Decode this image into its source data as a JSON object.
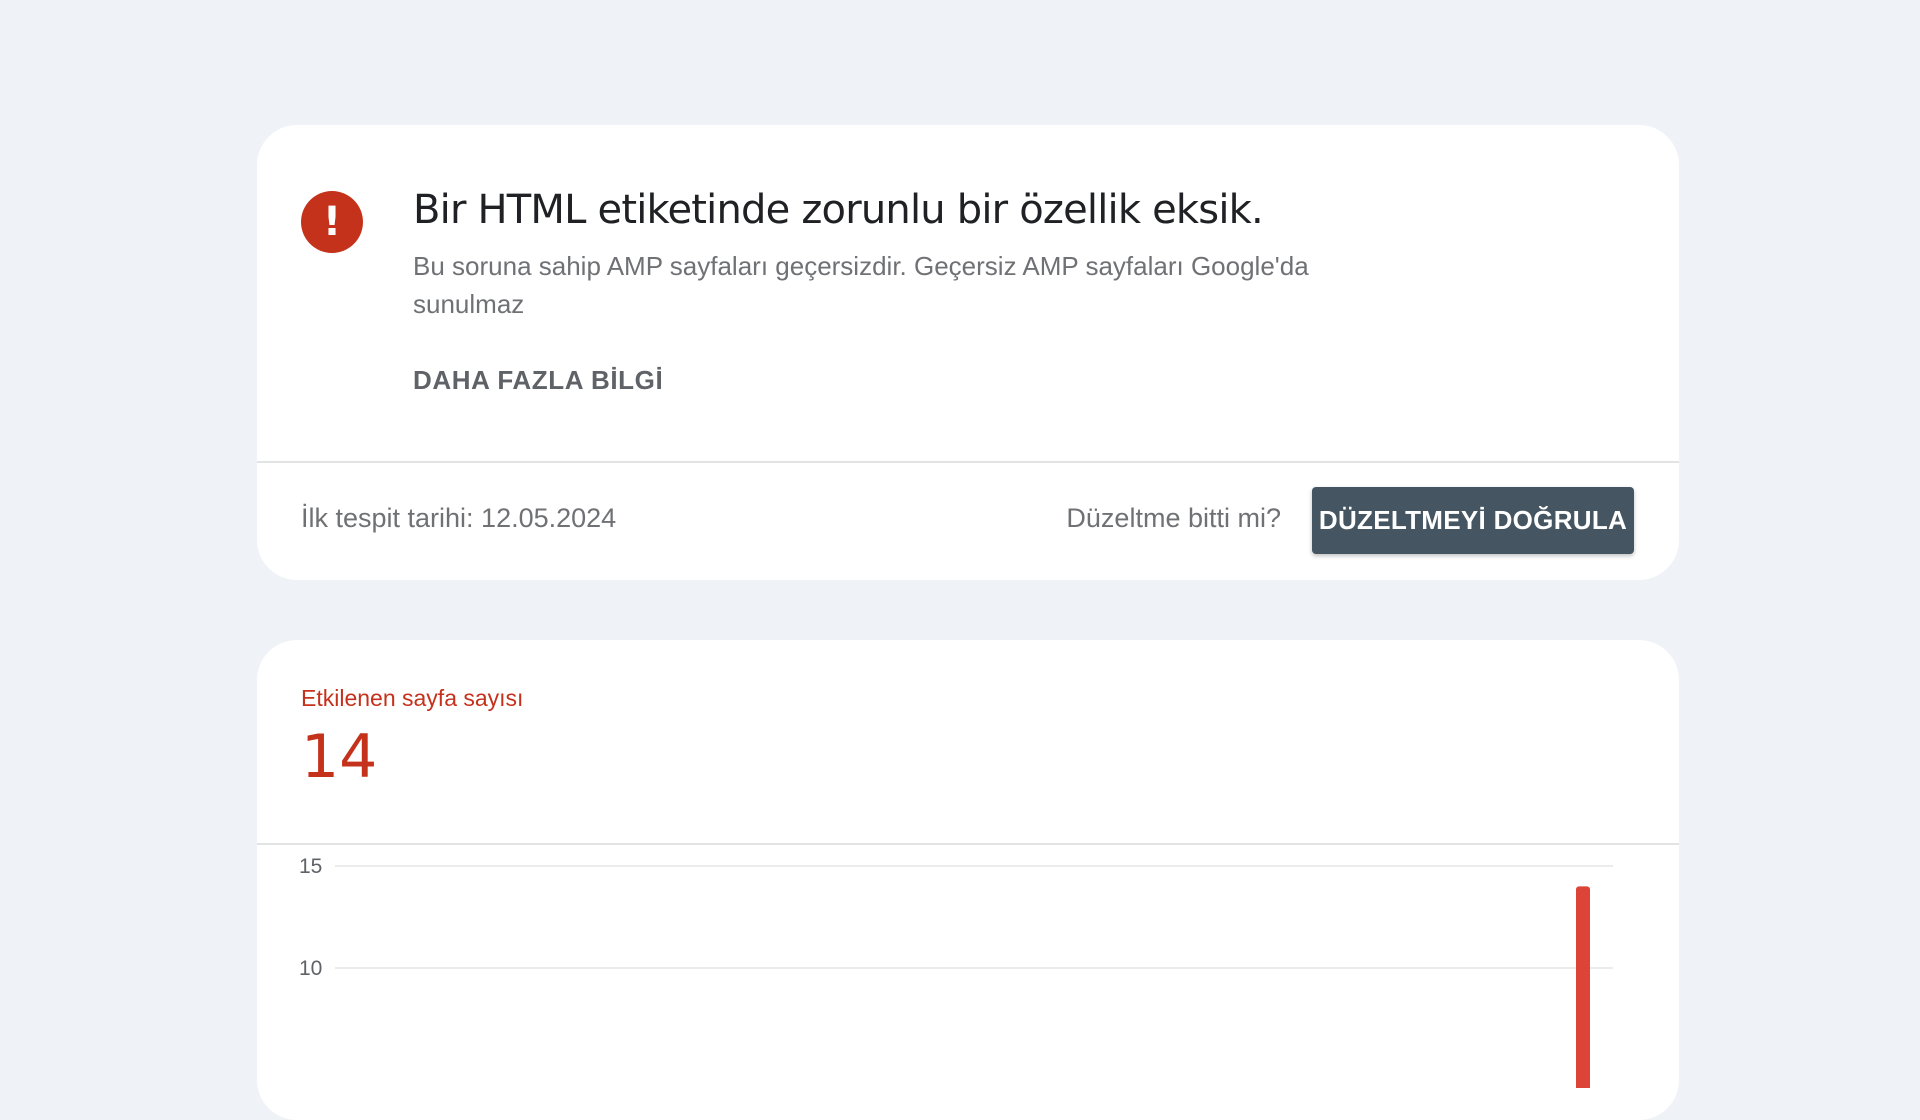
{
  "issue": {
    "title": "Bir HTML etiketinde zorunlu bir özellik eksik.",
    "description": "Bu soruna sahip AMP sayfaları geçersizdir. Geçersiz AMP sayfaları Google'da sunulmaz",
    "learn_more_label": "DAHA FAZLA BİLGİ",
    "first_detected": "İlk tespit tarihi: 12.05.2024",
    "fix_question": "Düzeltme bitti mi?",
    "validate_button_label": "DÜZELTMEYİ DOĞRULA",
    "icon": "error-icon",
    "icon_glyph": "!",
    "colors": {
      "error": "#c5321c",
      "button": "#455662"
    }
  },
  "affected": {
    "label": "Etkilenen sayfa sayısı",
    "value": "14"
  },
  "chart_data": {
    "type": "bar",
    "title": "",
    "xlabel": "",
    "ylabel": "",
    "y_ticks": [
      15,
      10
    ],
    "ylim": [
      0,
      15
    ],
    "grid": true,
    "color": "#db4437",
    "series": [
      {
        "values": [
          14
        ]
      }
    ]
  }
}
